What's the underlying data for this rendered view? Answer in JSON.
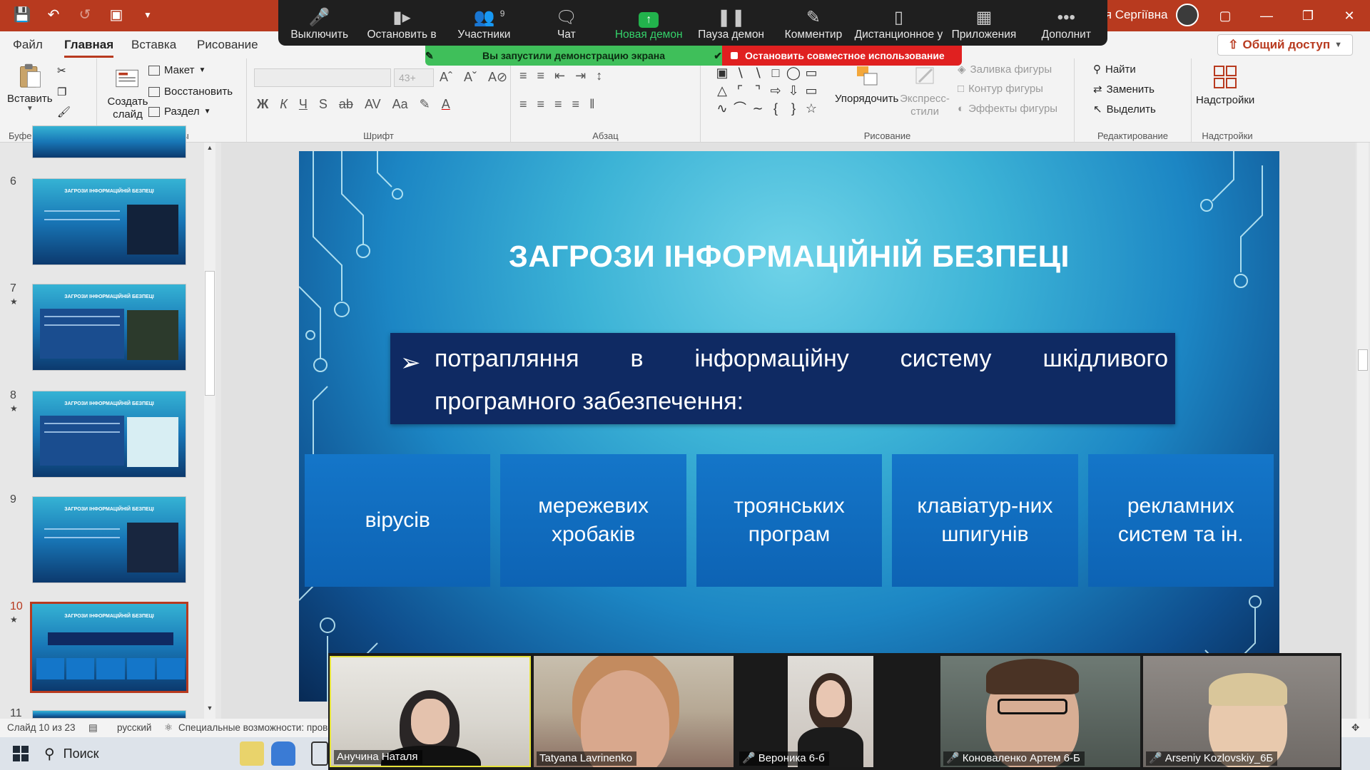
{
  "app": {
    "user_name": "ія Сергіївна",
    "share_button": "Общий доступ"
  },
  "tabs": [
    "Файл",
    "Главная",
    "Вставка",
    "Рисование"
  ],
  "ribbon": {
    "clipboard": {
      "paste": "Вставить",
      "label": "Буфер обмена"
    },
    "slides": {
      "new_slide": "Создать слайд",
      "layout": "Макет",
      "reset": "Восстановить",
      "section": "Раздел",
      "label": "Слайды"
    },
    "font": {
      "size": "43+",
      "label": "Шрифт"
    },
    "paragraph": {
      "label": "Абзац"
    },
    "drawing": {
      "arrange": "Упорядочить",
      "quick_styles": "Экспресс-стили",
      "fill": "Заливка фигуры",
      "outline": "Контур фигуры",
      "effects": "Эффекты фигуры",
      "label": "Рисование"
    },
    "editing": {
      "find": "Найти",
      "replace": "Заменить",
      "select": "Выделить",
      "label": "Редактирование"
    },
    "addins": {
      "button": "Надстройки",
      "label": "Надстройки"
    }
  },
  "zoom_toolbar": {
    "items": [
      {
        "label": "Выключить",
        "icon": "microphone-icon"
      },
      {
        "label": "Остановить в",
        "icon": "video-camera-icon"
      },
      {
        "label": "Участники",
        "icon": "participants-icon",
        "count": "9"
      },
      {
        "label": "Чат",
        "icon": "chat-icon"
      },
      {
        "label": "Новая демон",
        "icon": "share-screen-icon"
      },
      {
        "label": "Пауза демон",
        "icon": "pause-icon"
      },
      {
        "label": "Комментир",
        "icon": "pen-icon"
      },
      {
        "label": "Дистанционное у",
        "icon": "mouse-icon"
      },
      {
        "label": "Приложения",
        "icon": "apps-icon"
      },
      {
        "label": "Дополнит",
        "icon": "more-icon"
      }
    ],
    "sharing_notice": "Вы запустили демонстрацию экрана",
    "stop_sharing": "Остановить совместное использование"
  },
  "thumbnails": [
    {
      "num": "6",
      "title": "ЗАГРОЗИ ІНФОРМАЦІЙНІЙ БЕЗПЕЦІ",
      "star": false
    },
    {
      "num": "7",
      "title": "ЗАГРОЗИ ІНФОРМАЦІЙНІЙ БЕЗПЕЦІ",
      "star": true
    },
    {
      "num": "8",
      "title": "ЗАГРОЗИ ІНФОРМАЦІЙНІЙ БЕЗПЕЦІ",
      "star": true
    },
    {
      "num": "9",
      "title": "ЗАГРОЗИ ІНФОРМАЦІЙНІЙ БЕЗПЕЦІ",
      "star": false
    },
    {
      "num": "10",
      "title": "ЗАГРОЗИ ІНФОРМАЦІЙНІЙ БЕЗПЕЦІ",
      "star": true
    },
    {
      "num": "11"
    }
  ],
  "slide": {
    "title": "ЗАГРОЗИ ІНФОРМАЦІЙНІЙ БЕЗПЕЦІ",
    "bullet_words": [
      "потрапляння",
      "в",
      "інформаційну",
      "систему",
      "шкідливого"
    ],
    "bullet_line2": "програмного забезпечення:",
    "boxes": [
      "вірусів",
      "мережевих хробаків",
      "троянських програм",
      "клавіатур-них шпигунів",
      "рекламних систем та ін."
    ]
  },
  "status": {
    "slide_info": "Слайд 10 из 23",
    "language": "русский",
    "accessibility": "Специальные возможности: прове"
  },
  "taskbar": {
    "search": "Поиск"
  },
  "participants": [
    {
      "name": "Анучина Наталя",
      "muted": false
    },
    {
      "name": "Tatyana Lavrinenko",
      "muted": false
    },
    {
      "name": "Вероника 6-б",
      "muted": true
    },
    {
      "name": "Коноваленко Артем 6-Б",
      "muted": true
    },
    {
      "name": "Arseniy Kozlovskiy_6Б",
      "muted": true
    }
  ],
  "colors": {
    "accent": "#b83a1f",
    "zoom_green": "#22b24c",
    "stop_red": "#e02020",
    "slide_box": "#1476c9",
    "slide_textbox": "#0f2a63"
  }
}
